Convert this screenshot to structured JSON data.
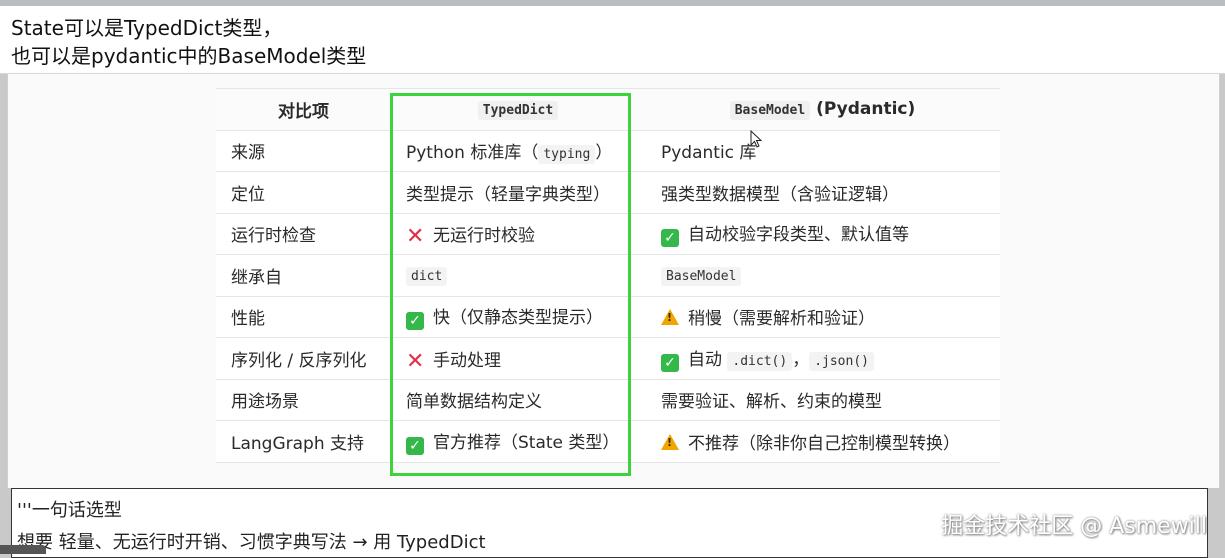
{
  "header": {
    "line1": "State可以是TypedDict类型，",
    "line2": "也可以是pydantic中的BaseModel类型"
  },
  "table": {
    "headers": {
      "col1": "对比项",
      "col2": "TypedDict",
      "col3_code": "BaseModel",
      "col3_suffix": " (Pydantic)"
    },
    "rows": [
      {
        "label": "来源",
        "typeddict": {
          "text": "Python 标准库（",
          "code": "typing",
          "text_after": "）"
        },
        "basemodel": {
          "text": "Pydantic 库"
        }
      },
      {
        "label": "定位",
        "typeddict": {
          "text": "类型提示（轻量字典类型）"
        },
        "basemodel": {
          "text": "强类型数据模型（含验证逻辑）"
        }
      },
      {
        "label": "运行时检查",
        "typeddict": {
          "icon": "cross-icon",
          "text": "无运行时校验"
        },
        "basemodel": {
          "icon": "check-icon",
          "text": "自动校验字段类型、默认值等"
        }
      },
      {
        "label": "继承自",
        "typeddict": {
          "code": "dict"
        },
        "basemodel": {
          "code": "BaseModel"
        }
      },
      {
        "label": "性能",
        "typeddict": {
          "icon": "check-icon",
          "text": "快（仅静态类型提示）"
        },
        "basemodel": {
          "icon": "warning-icon",
          "text": "稍慢（需要解析和验证）"
        }
      },
      {
        "label": "序列化 / 反序列化",
        "typeddict": {
          "icon": "cross-icon",
          "text": "手动处理"
        },
        "basemodel": {
          "icon": "check-icon",
          "text": "自动",
          "code": ".dict()",
          "sep": "，",
          "code2": ".json()"
        }
      },
      {
        "label": "用途场景",
        "typeddict": {
          "text": "简单数据结构定义"
        },
        "basemodel": {
          "text": "需要验证、解析、约束的模型"
        }
      },
      {
        "label": "LangGraph 支持",
        "typeddict": {
          "icon": "check-icon",
          "text": "官方推荐（State 类型）"
        },
        "basemodel": {
          "icon": "warning-icon",
          "text": "不推荐（除非你自己控制模型转换）"
        }
      }
    ]
  },
  "note": {
    "line1": "'''一句话选型",
    "line2": "想要 轻量、无运行时开销、习惯字典写法 → 用 TypedDict"
  },
  "watermark": "掘金技术社区 @ Asmewill",
  "colors": {
    "highlight": "#3cd33c",
    "check": "#34b84a",
    "cross": "#e0304a",
    "warning": "#f0a500"
  }
}
